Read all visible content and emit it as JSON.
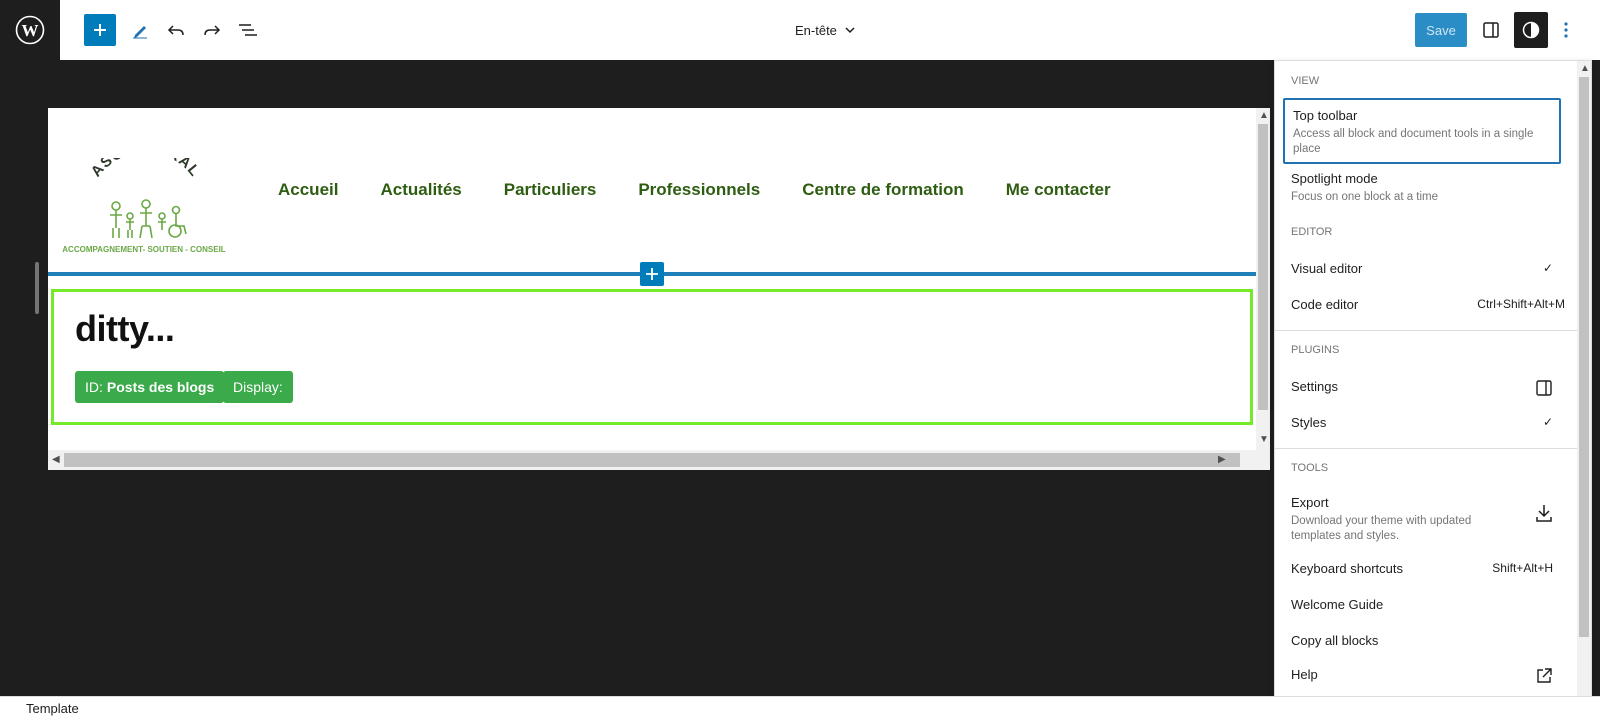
{
  "topbar": {
    "doc_title": "En-tête",
    "save_label": "Save"
  },
  "canvas": {
    "logo": {
      "title": "ASC LIBÉRAL",
      "tagline": "ACCOMPAGNEMENT- SOUTIEN - CONSEIL"
    },
    "nav": [
      "Accueil",
      "Actualités",
      "Particuliers",
      "Professionnels",
      "Centre de formation",
      "Me contacter"
    ],
    "ditty": {
      "title": "ditty...",
      "id_prefix": "ID:",
      "id_value": "Posts des blogs",
      "display_label": "Display:"
    }
  },
  "menu": {
    "view": {
      "label": "VIEW",
      "items": [
        {
          "label": "Top toolbar",
          "desc": "Access all block and document tools in a single place"
        },
        {
          "label": "Spotlight mode",
          "desc": "Focus on one block at a time"
        }
      ]
    },
    "editor": {
      "label": "EDITOR",
      "items": [
        {
          "label": "Visual editor",
          "shortcut": "✓"
        },
        {
          "label": "Code editor",
          "shortcut": "Ctrl+Shift+Alt+M"
        }
      ]
    },
    "plugins": {
      "label": "PLUGINS",
      "items": [
        {
          "label": "Settings",
          "icon": "sidebar-icon"
        },
        {
          "label": "Styles",
          "shortcut": "✓"
        }
      ]
    },
    "tools": {
      "label": "TOOLS",
      "items": [
        {
          "label": "Export",
          "desc": "Download your theme with updated templates and styles.",
          "icon": "download-icon"
        },
        {
          "label": "Keyboard shortcuts",
          "shortcut": "Shift+Alt+H"
        },
        {
          "label": "Welcome Guide"
        },
        {
          "label": "Copy all blocks"
        },
        {
          "label": "Help",
          "icon": "external-link-icon"
        }
      ]
    }
  },
  "footer": {
    "label": "Template"
  },
  "colors": {
    "accent": "#007cba",
    "nav_text": "#2e5d12",
    "chip_bg": "#3aaa4a",
    "ditty_border": "#75ea2a"
  }
}
